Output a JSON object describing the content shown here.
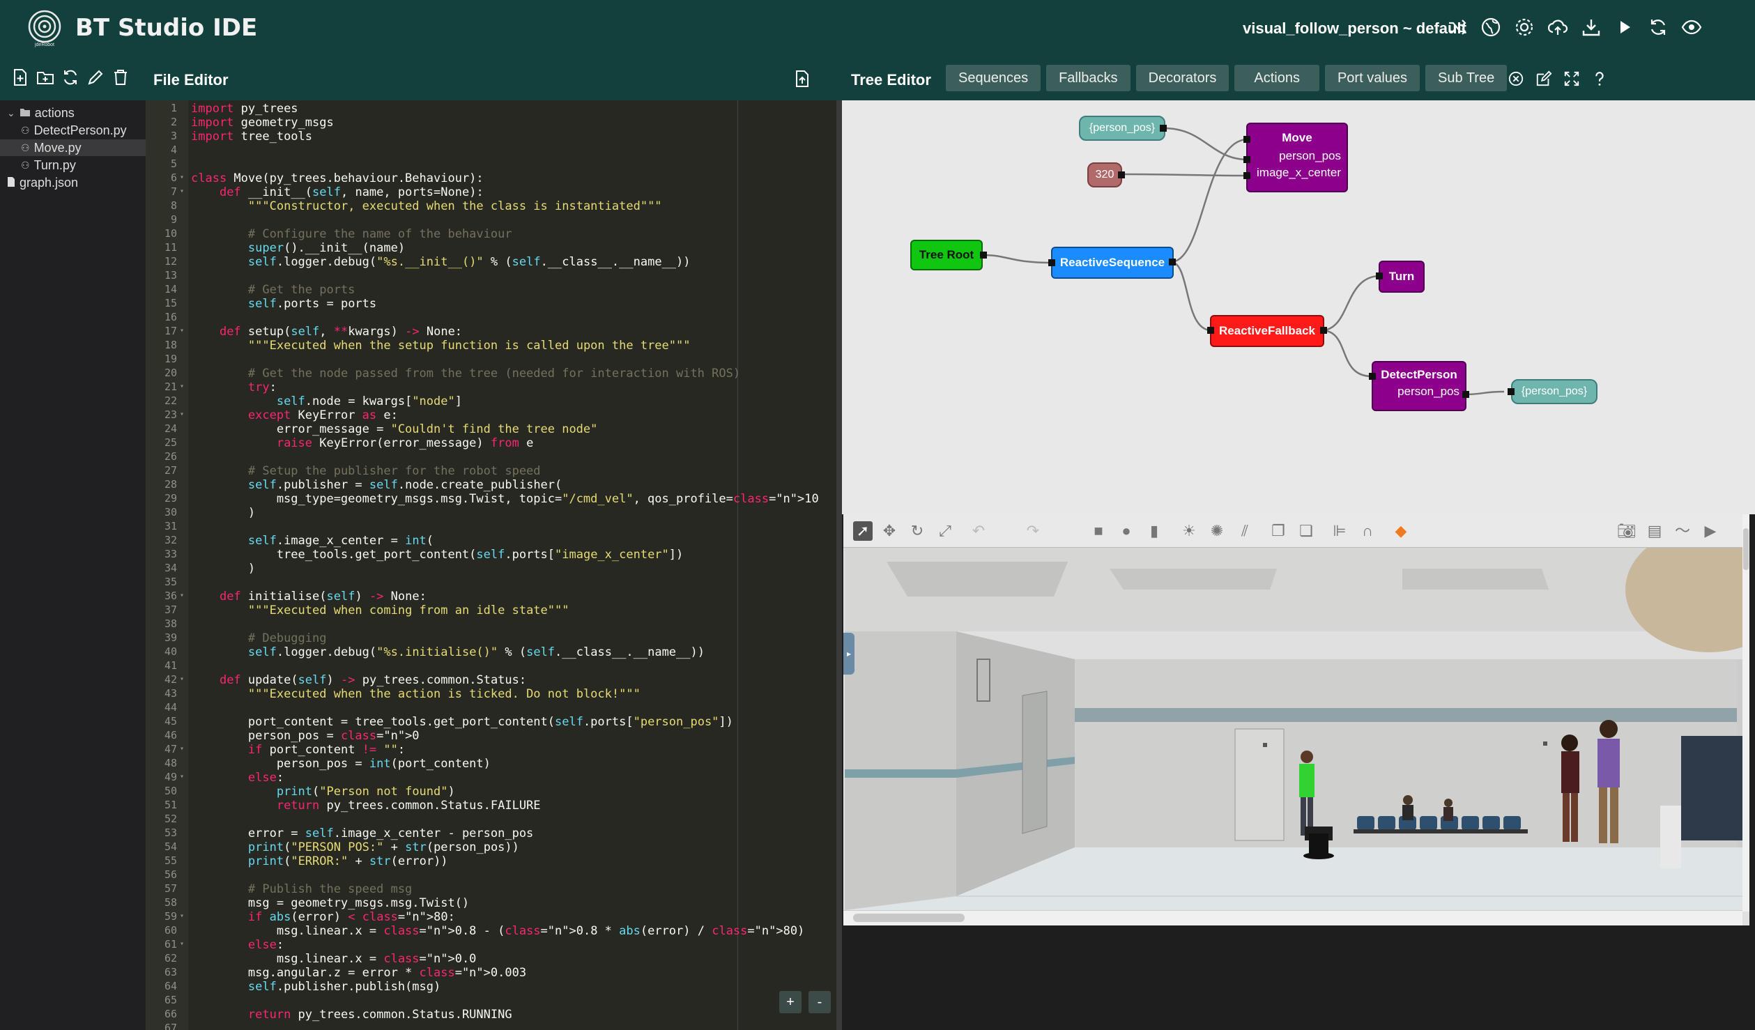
{
  "header": {
    "title": "BT Studio IDE",
    "project": "visual_follow_person ~ default",
    "icons": [
      "shuffle-icon",
      "globe-icon",
      "settings-icon",
      "cloud-upload-icon",
      "download-icon",
      "play-icon",
      "refresh-icon",
      "eye-icon"
    ]
  },
  "file_editor": {
    "title": "File Editor",
    "icons": [
      "new-file-icon",
      "new-folder-icon",
      "refresh-icon",
      "rename-icon",
      "delete-icon"
    ],
    "tree": [
      {
        "label": "actions",
        "type": "folder"
      },
      {
        "label": "DetectPerson.py",
        "type": "action"
      },
      {
        "label": "Move.py",
        "type": "action",
        "selected": true
      },
      {
        "label": "Turn.py",
        "type": "action"
      },
      {
        "label": "graph.json",
        "type": "file"
      }
    ]
  },
  "tree_editor": {
    "title": "Tree Editor",
    "tabs": [
      "Sequences",
      "Fallbacks",
      "Decorators",
      "Actions",
      "Port values",
      "Sub Tree"
    ],
    "icons": [
      "close-circle-icon",
      "edit-icon",
      "fullscreen-icon",
      "help-icon"
    ],
    "nodes": {
      "tree_root": "Tree Root",
      "reactive_sequence": "ReactiveSequence",
      "reactive_fallback": "ReactiveFallback",
      "move": "Move",
      "move_port1": "person_pos",
      "move_port2": "image_x_center",
      "turn": "Turn",
      "detect": "DetectPerson",
      "detect_port": "person_pos",
      "bb_person_pos_in": "{person_pos}",
      "bb_320": "320",
      "bb_person_pos_out": "{person_pos}"
    },
    "colors": {
      "root": "#11c611",
      "sequence": "#1a8cff",
      "fallback": "#ff1a1a",
      "action": "#8c008c",
      "blackboard": "#6eb6ad",
      "literal": "#b06a6a"
    }
  },
  "zoom": {
    "plus": "+",
    "minus": "-"
  },
  "code": [
    "import py_trees",
    "import geometry_msgs",
    "import tree_tools",
    "",
    "",
    "class Move(py_trees.behaviour.Behaviour):",
    "    def __init__(self, name, ports=None):",
    "        \"\"\"Constructor, executed when the class is instantiated\"\"\"",
    "",
    "        # Configure the name of the behaviour",
    "        super().__init__(name)",
    "        self.logger.debug(\"%s.__init__()\" % (self.__class__.__name__))",
    "",
    "        # Get the ports",
    "        self.ports = ports",
    "",
    "    def setup(self, **kwargs) -> None:",
    "        \"\"\"Executed when the setup function is called upon the tree\"\"\"",
    "",
    "        # Get the node passed from the tree (needed for interaction with ROS)",
    "        try:",
    "            self.node = kwargs[\"node\"]",
    "        except KeyError as e:",
    "            error_message = \"Couldn't find the tree node\"",
    "            raise KeyError(error_message) from e",
    "",
    "        # Setup the publisher for the robot speed",
    "        self.publisher = self.node.create_publisher(",
    "            msg_type=geometry_msgs.msg.Twist, topic=\"/cmd_vel\", qos_profile=10",
    "        )",
    "",
    "        self.image_x_center = int(",
    "            tree_tools.get_port_content(self.ports[\"image_x_center\"])",
    "        )",
    "",
    "    def initialise(self) -> None:",
    "        \"\"\"Executed when coming from an idle state\"\"\"",
    "",
    "        # Debugging",
    "        self.logger.debug(\"%s.initialise()\" % (self.__class__.__name__))",
    "",
    "    def update(self) -> py_trees.common.Status:",
    "        \"\"\"Executed when the action is ticked. Do not block!\"\"\"",
    "",
    "        port_content = tree_tools.get_port_content(self.ports[\"person_pos\"])",
    "        person_pos = 0",
    "        if port_content != \"\":",
    "            person_pos = int(port_content)",
    "        else:",
    "            print(\"Person not found\")",
    "            return py_trees.common.Status.FAILURE",
    "",
    "        error = self.image_x_center - person_pos",
    "        print(\"PERSON POS:\" + str(person_pos))",
    "        print(\"ERROR:\" + str(error))",
    "",
    "        # Publish the speed msg",
    "        msg = geometry_msgs.msg.Twist()",
    "        if abs(error) < 80:",
    "            msg.linear.x = 0.8 - (0.8 * abs(error) / 80)",
    "        else:",
    "            msg.linear.x = 0.0",
    "        msg.angular.z = error * 0.003",
    "        self.publisher.publish(msg)",
    "",
    "        return py_trees.common.Status.RUNNING",
    ""
  ],
  "fold_lines": [
    6,
    7,
    17,
    21,
    23,
    36,
    42,
    47,
    49,
    59,
    61
  ]
}
